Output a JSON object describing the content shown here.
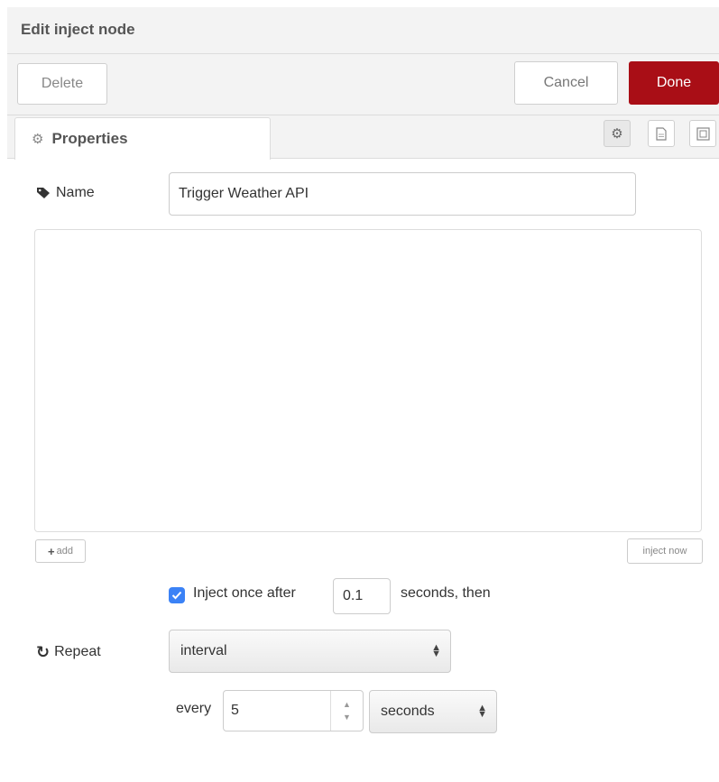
{
  "dialog": {
    "title": "Edit inject node"
  },
  "toolbar": {
    "delete_label": "Delete",
    "cancel_label": "Cancel",
    "done_label": "Done"
  },
  "tabs": {
    "properties_label": "Properties",
    "icons": [
      "gear-icon",
      "file-icon",
      "frame-icon"
    ]
  },
  "form": {
    "name_label": "Name",
    "name_value": "Trigger Weather API",
    "add_label": "add",
    "inject_now_label": "inject now",
    "once": {
      "checked": true,
      "label": "Inject once after",
      "delay": "0.1",
      "suffix": "seconds, then"
    },
    "repeat": {
      "label": "Repeat",
      "mode": "interval",
      "every_label": "every",
      "every_value": "5",
      "units": "seconds"
    }
  },
  "colors": {
    "done_bg": "#a90e16",
    "checkbox": "#3b82f6",
    "chrome_bg": "#f3f3f3"
  }
}
